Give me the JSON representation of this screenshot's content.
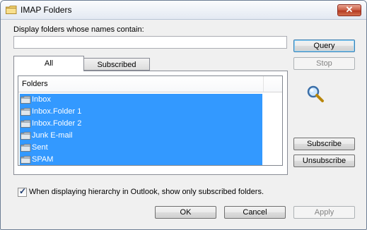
{
  "window": {
    "title": "IMAP Folders"
  },
  "search": {
    "label": "Display folders whose names contain:",
    "value": ""
  },
  "buttons": {
    "query": "Query",
    "stop": "Stop",
    "subscribe": "Subscribe",
    "unsubscribe": "Unsubscribe",
    "ok": "OK",
    "cancel": "Cancel",
    "apply": "Apply"
  },
  "tabs": [
    {
      "label": "All",
      "active": true
    },
    {
      "label": "Subscribed",
      "active": false
    }
  ],
  "list": {
    "header": "Folders",
    "items": [
      {
        "label": "Inbox"
      },
      {
        "label": "Inbox.Folder 1"
      },
      {
        "label": "Inbox.Folder 2"
      },
      {
        "label": "Junk E-mail"
      },
      {
        "label": "Sent"
      },
      {
        "label": "SPAM"
      }
    ]
  },
  "option": {
    "label": "When displaying hierarchy in Outlook, show only subscribed folders.",
    "checked": true
  },
  "icons": {
    "title": "folder-icon",
    "item": "folder-icon",
    "search": "magnifier-icon",
    "close": "close-icon"
  },
  "colors": {
    "selection": "#3399ff",
    "close_button": "#c95a42"
  }
}
